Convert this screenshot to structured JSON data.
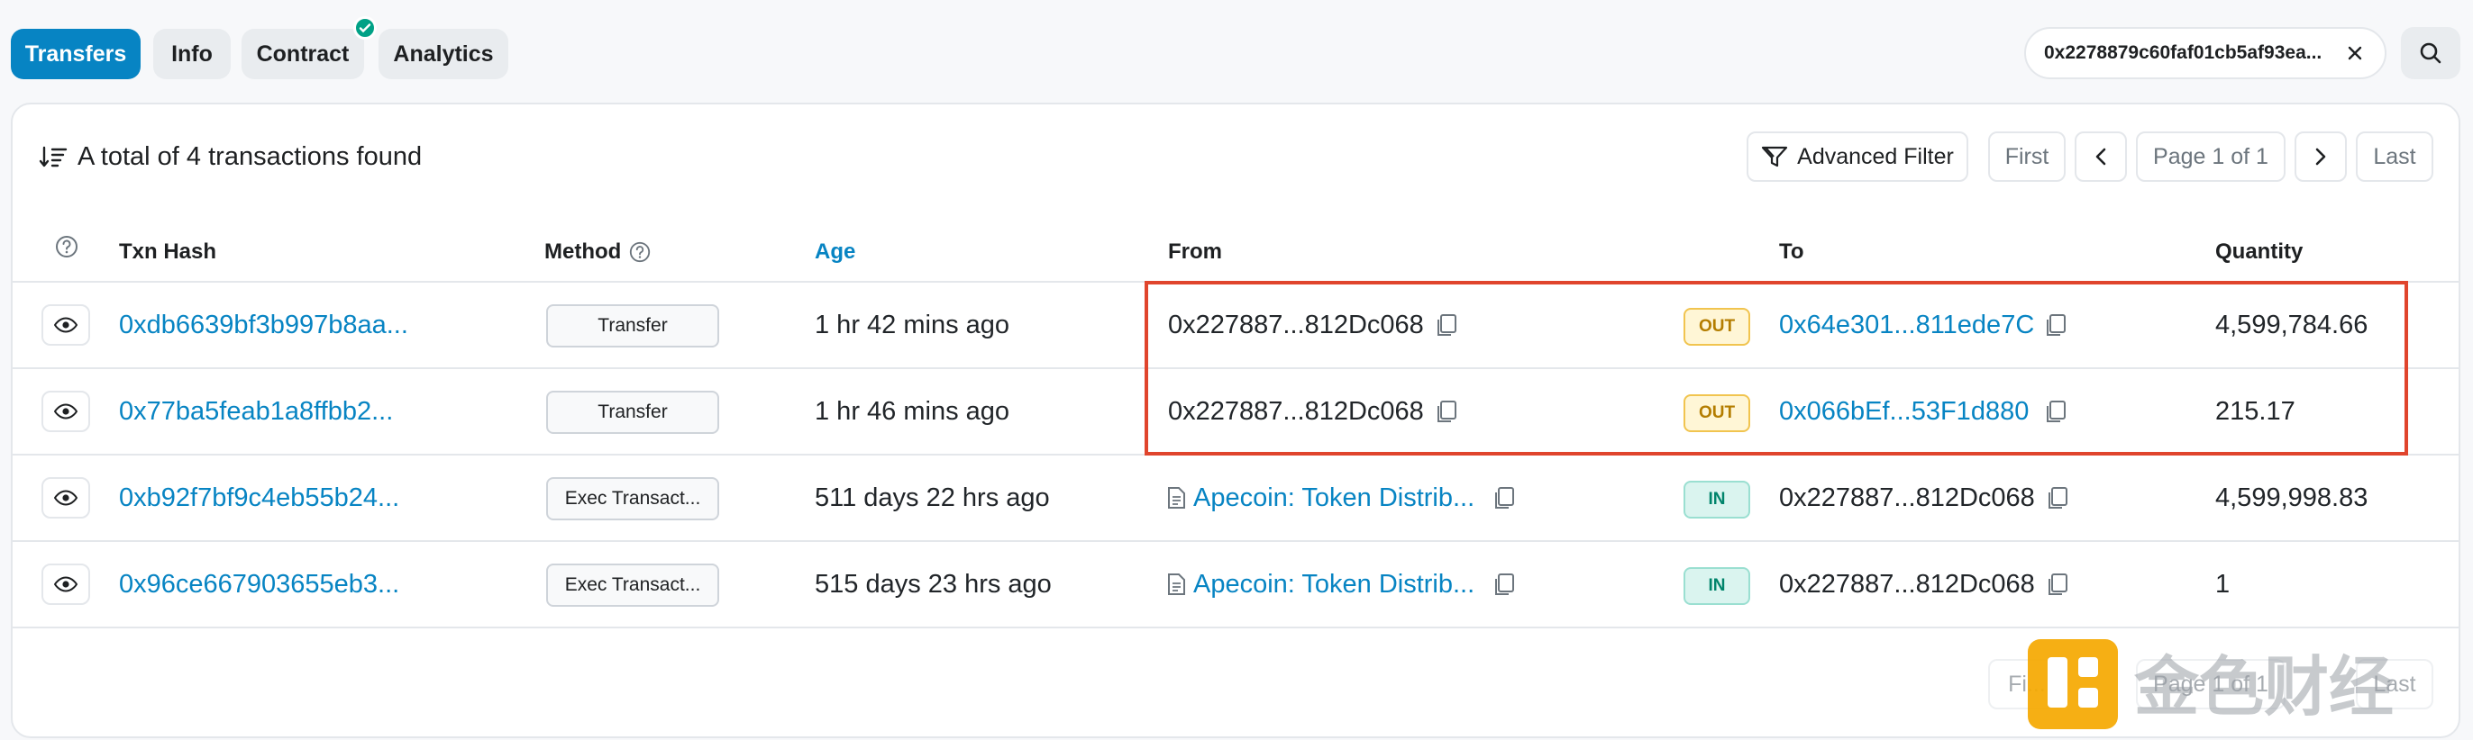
{
  "tabs": [
    {
      "label": "Transfers",
      "active": true
    },
    {
      "label": "Info",
      "active": false
    },
    {
      "label": "Contract",
      "active": false
    },
    {
      "label": "Analytics",
      "active": false
    }
  ],
  "address_filter": "0x2278879c60faf01cb5af93ea...",
  "summary": "A total of 4 transactions found",
  "toolbar": {
    "advanced_filter": "Advanced Filter",
    "first": "First",
    "page": "Page 1 of 1",
    "last": "Last"
  },
  "columns": {
    "txn_hash": "Txn Hash",
    "method": "Method",
    "age": "Age",
    "from": "From",
    "to": "To",
    "quantity": "Quantity"
  },
  "rows": [
    {
      "hash": "0xdb6639bf3b997b8aa...",
      "method": "Transfer",
      "age": "1 hr 42 mins ago",
      "from": "0x227887...812Dc068",
      "from_is_contract": false,
      "direction": "OUT",
      "to": "0x64e301...811ede7C",
      "to_is_link": true,
      "quantity": "4,599,784.66"
    },
    {
      "hash": "0x77ba5feab1a8ffbb2...",
      "method": "Transfer",
      "age": "1 hr 46 mins ago",
      "from": "0x227887...812Dc068",
      "from_is_contract": false,
      "direction": "OUT",
      "to": "0x066bEf...53F1d880",
      "to_is_link": true,
      "quantity": "215.17"
    },
    {
      "hash": "0xb92f7bf9c4eb55b24...",
      "method": "Exec Transact...",
      "age": "511 days 22 hrs ago",
      "from": "Apecoin: Token Distrib...",
      "from_is_contract": true,
      "direction": "IN",
      "to": "0x227887...812Dc068",
      "to_is_link": false,
      "quantity": "4,599,998.83"
    },
    {
      "hash": "0x96ce667903655eb3...",
      "method": "Exec Transact...",
      "age": "515 days 23 hrs ago",
      "from": "Apecoin: Token Distrib...",
      "from_is_contract": true,
      "direction": "IN",
      "to": "0x227887...812Dc068",
      "to_is_link": false,
      "quantity": "1"
    }
  ],
  "bottom_pagination": {
    "first": "Fi...",
    "page": "Page 1 of 1",
    "last": "Last"
  },
  "watermark_text": "金色财经",
  "colors": {
    "accent": "#0784c3",
    "highlight": "#e0452d",
    "out": "#b47d00",
    "in": "#00846b"
  }
}
